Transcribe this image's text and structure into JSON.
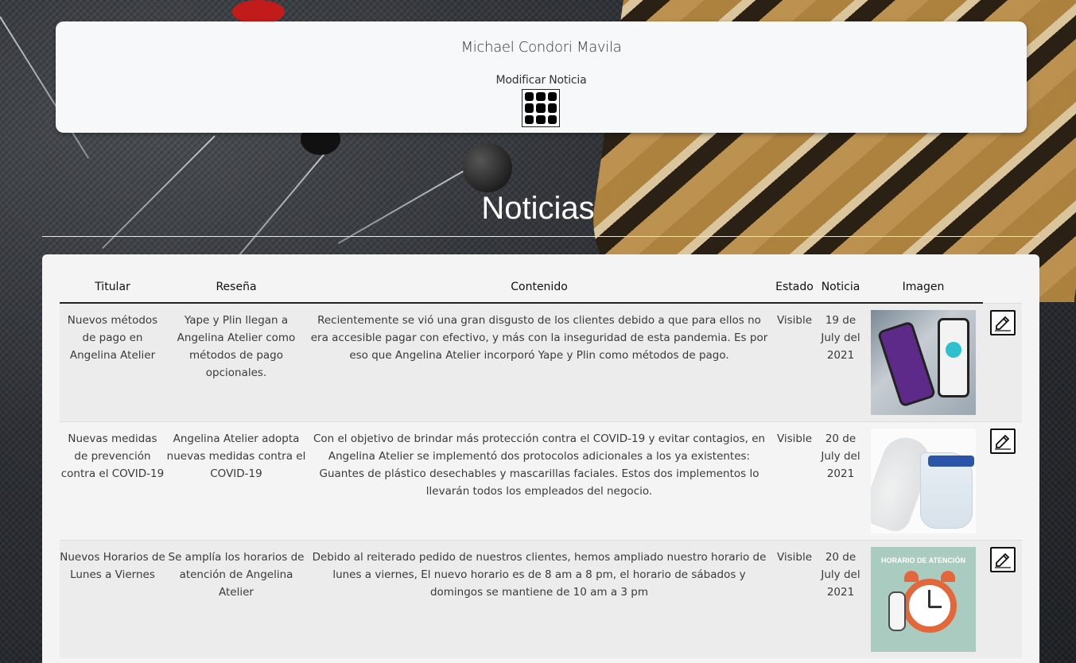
{
  "header": {
    "user_name": "Michael Condori Mavila",
    "modify_label": "Modificar Noticia",
    "menu_icon": "grid-menu-icon"
  },
  "page": {
    "title": "Noticias"
  },
  "table": {
    "columns": [
      "Titular",
      "Reseña",
      "Contenido",
      "Estado",
      "Noticia",
      "Imagen",
      ""
    ],
    "rows": [
      {
        "titular": "Nuevos métodos de pago en Angelina Atelier",
        "resena": "Yape y Plin llegan a Angelina Atelier como métodos de pago opcionales.",
        "contenido": "Recientemente se vió una gran disgusto de los clientes debido a que para ellos no era accesible pagar con efectivo, y más con la inseguridad de esta pandemia. Es por eso que Angelina Atelier incorporó Yape y Plin como métodos de pago.",
        "estado": "Visible",
        "fecha": "19 de July del 2021",
        "image_icon": "payment-phones-image"
      },
      {
        "titular": "Nuevas medidas de prevención contra el COVID-19",
        "resena": "Angelina Atelier adopta nuevas medidas contra el COVID-19",
        "contenido": "Con el objetivo de brindar más protección contra el COVID-19 y evitar contagios, en Angelina Atelier se implementó dos protocolos adicionales a los ya existentes: Guantes de plástico desechables y mascarillas faciales. Estos dos implementos lo llevarán todos los empleados del negocio.",
        "estado": "Visible",
        "fecha": "20 de July del 2021",
        "image_icon": "gloves-face-shield-image"
      },
      {
        "titular": "Nuevos Horarios de Lunes a Viernes",
        "resena": "Se amplía los horarios de atención de Angelina Atelier",
        "contenido": "Debido al reiterado pedido de nuestros clientes, hemos ampliado nuestro horario de lunes a viernes, El nuevo horario es de 8 am a 8 pm, el horario de sábados y domingos se mantiene de 10 am a 3 pm",
        "estado": "Visible",
        "fecha": "20 de July del 2021",
        "image_icon": "alarm-clock-image",
        "image_caption": "HORARIO DE ATENCIÓN"
      }
    ]
  },
  "icons": {
    "edit": "edit-pencil-icon"
  },
  "colors": {
    "card_bg": "#f7f8f9",
    "table_bg": "#f4f4f4",
    "row_alt": "#ececec",
    "title_text": "#ffffff"
  }
}
